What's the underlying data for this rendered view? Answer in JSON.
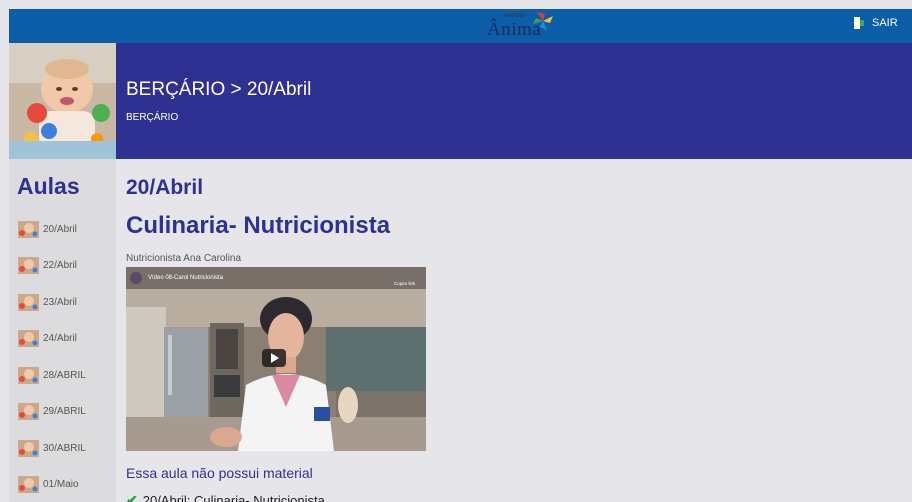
{
  "header": {
    "logo_small": "Instituto",
    "logo_main": "Ânima",
    "logout_label": "SAIR"
  },
  "banner": {
    "title": "BERÇÁRIO > 20/Abril",
    "subtitle": "BERÇÁRIO"
  },
  "sidebar": {
    "heading": "Aulas",
    "items": [
      {
        "label": "20/Abril"
      },
      {
        "label": "22/Abril"
      },
      {
        "label": "23/Abril"
      },
      {
        "label": "24/Abril"
      },
      {
        "label": "28/ABRIL"
      },
      {
        "label": "29/ABRIL"
      },
      {
        "label": "30/ABRIL"
      },
      {
        "label": "01/Maio"
      }
    ]
  },
  "main": {
    "date_title": "20/Abril",
    "lesson_title": "Culinaria- Nutricionista",
    "subtitle": "Nutricionista Ana Carolina",
    "video": {
      "title": "Vídeo 08-Carol Nutricionista",
      "copy_link": "Copiar link"
    },
    "no_material": "Essa aula não possui material",
    "completed_item": "20/Abril: Culinaria- Nutricionista"
  },
  "colors": {
    "topbar": "#0d5ea8",
    "banner": "#2e3192",
    "heading": "#2e3192",
    "check": "#23a347"
  }
}
